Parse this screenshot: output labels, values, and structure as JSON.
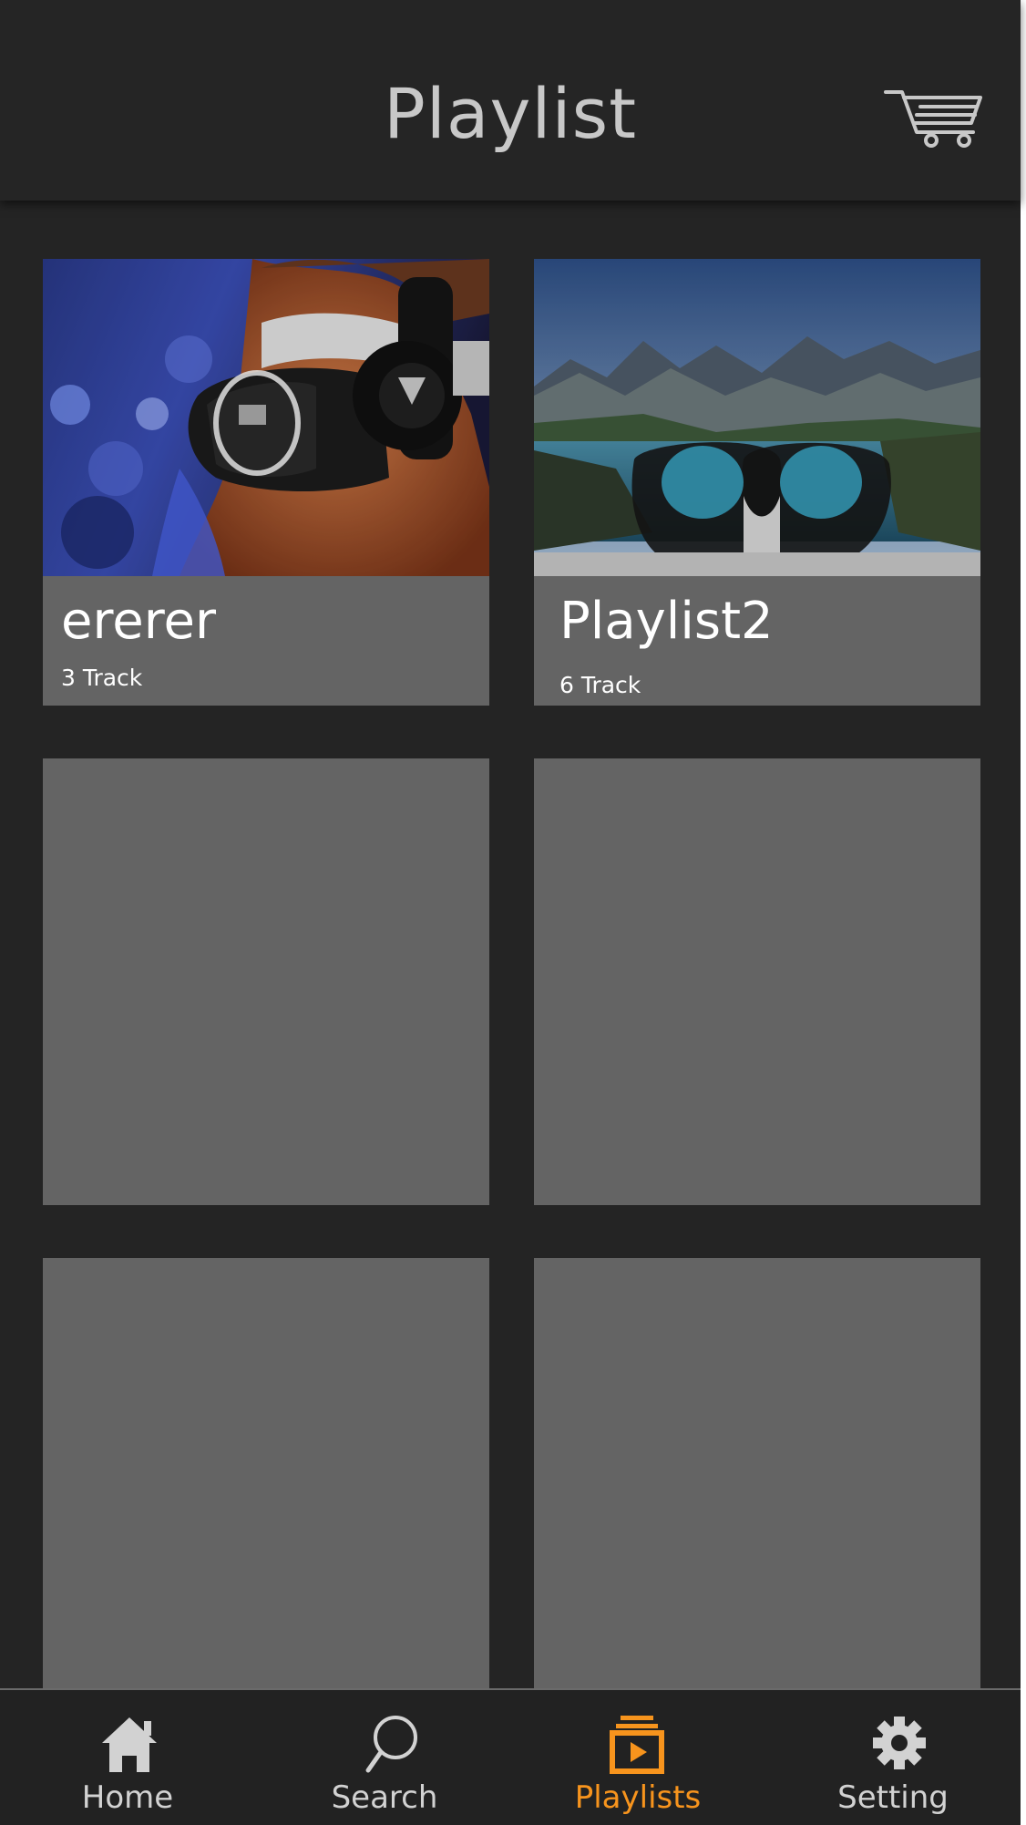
{
  "header": {
    "title": "Playlist",
    "cart_icon": "cart-icon"
  },
  "playlists": [
    {
      "name": "ererer",
      "track_count": "3 Track",
      "thumbnail": "vr-headset-person-photo"
    },
    {
      "name": "Playlist2",
      "track_count": "6 Track",
      "thumbnail": "vr-goggles-mountain-lake-photo"
    }
  ],
  "placeholder_cards": 4,
  "nav": {
    "items": [
      {
        "label": "Home",
        "icon": "home-icon",
        "active": false
      },
      {
        "label": "Search",
        "icon": "search-icon",
        "active": false
      },
      {
        "label": "Playlists",
        "icon": "playlists-icon",
        "active": true
      },
      {
        "label": "Setting",
        "icon": "gear-icon",
        "active": false
      }
    ]
  },
  "colors": {
    "background": "#242424",
    "card": "#646464",
    "accent": "#f7941d",
    "nav_inactive": "#d2d2d2"
  }
}
